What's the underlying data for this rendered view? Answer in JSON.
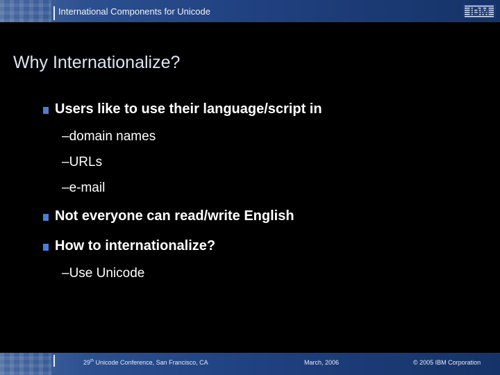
{
  "header": {
    "title": "International Components for Unicode",
    "logo_text": "IBM",
    "icons": [
      "divider-bar-icon",
      "ibm-logo-icon"
    ]
  },
  "slide": {
    "title": "Why Internationalize?",
    "bullets": [
      {
        "text": "Users like to use their language/script in",
        "subitems": [
          "–domain names",
          "–URLs",
          "–e-mail"
        ]
      },
      {
        "text": "Not everyone can read/write English",
        "subitems": []
      },
      {
        "text": "How to internationalize?",
        "subitems": [
          "–Use Unicode"
        ]
      }
    ]
  },
  "footer": {
    "conference_prefix": "29",
    "conference_sup": "th",
    "conference_rest": " Unicode Conference, San Francisco, CA",
    "date": "March, 2006",
    "copyright": "© 2005 IBM Corporation"
  },
  "colors": {
    "background": "#000000",
    "band_dark": "#163368",
    "band_light": "#4a6aa0",
    "title_text": "#dde4f2",
    "bullet_square": "#4a7fd6"
  }
}
